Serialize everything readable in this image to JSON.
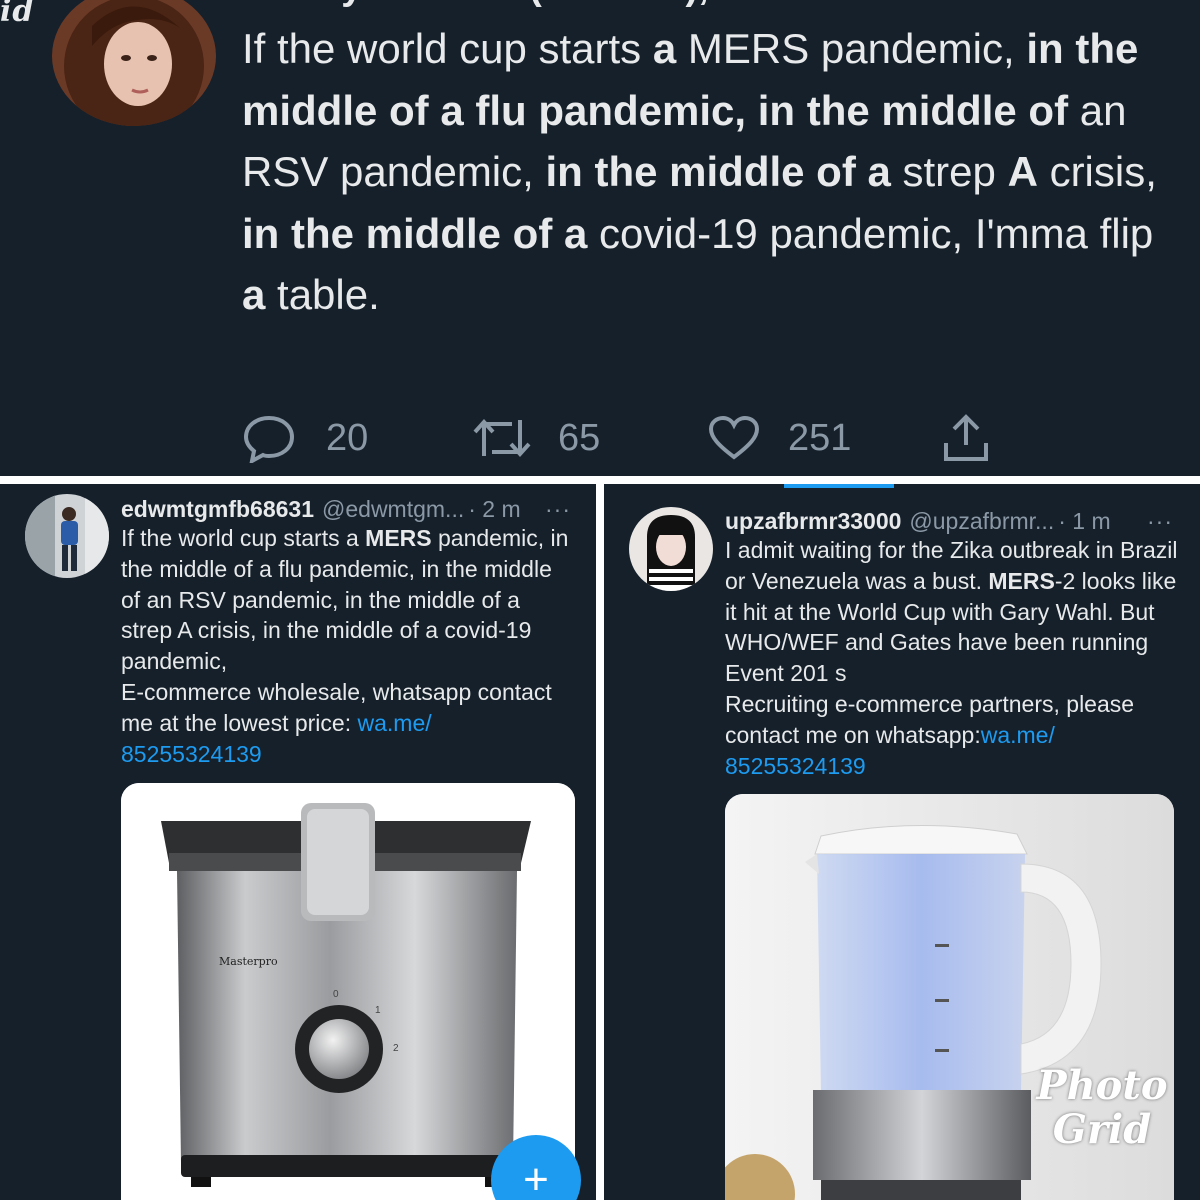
{
  "top_tweet": {
    "corner_mark": "id",
    "author_cut": "Kathryn Henzie (She/Her), Realit",
    "segments": [
      {
        "t": "If the world cup starts ",
        "b": false
      },
      {
        "t": "a",
        "b": true
      },
      {
        "t": " MERS pandemic, ",
        "b": false
      },
      {
        "t": "in the middle of a flu pandemic, in the middle of",
        "b": true
      },
      {
        "t": " an RSV pandemic, ",
        "b": false
      },
      {
        "t": "in the middle of a",
        "b": true
      },
      {
        "t": " strep ",
        "b": false
      },
      {
        "t": "A",
        "b": true
      },
      {
        "t": " crisis, ",
        "b": false
      },
      {
        "t": "in the middle of a",
        "b": true
      },
      {
        "t": " covid-19 pandemic, I'mma flip ",
        "b": false
      },
      {
        "t": "a",
        "b": true
      },
      {
        "t": " table.",
        "b": false
      }
    ],
    "replies": "20",
    "retweets": "65",
    "likes": "251",
    "icons": [
      "reply-icon",
      "retweet-icon",
      "like-icon",
      "share-icon"
    ]
  },
  "left_tweet": {
    "name": "edwmtgmfb68631",
    "handle": "@edwmtgm...",
    "time": "· 2 m",
    "more": "···",
    "segments": [
      {
        "t": "If the world cup starts a ",
        "b": false
      },
      {
        "t": "MERS",
        "b": true
      },
      {
        "t": " pandemic, in the middle of a flu pandemic, in the middle of an RSV pandemic, in the middle of a strep A crisis, in the middle of a covid-19 pandemic,",
        "b": false
      }
    ],
    "line2": "E-commerce wholesale, whatsapp contact me at the lowest price: ",
    "link": "wa.me/ 85255324139",
    "media_brand": "Masterpro",
    "media_dial_marks": [
      "0",
      "1",
      "2"
    ],
    "fab_label": "+"
  },
  "right_tweet": {
    "name": "upzafbrmr33000",
    "handle": "@upzafbrmr...",
    "time": "· 1 m",
    "more": "···",
    "segments": [
      {
        "t": "I admit waiting for the Zika outbreak in Brazil or Venezuela was a bust. ",
        "b": false
      },
      {
        "t": "MERS",
        "b": true
      },
      {
        "t": "-2 looks like it hit at the World Cup with Gary Wahl. But WHO/WEF and Gates have been running Event 201 s",
        "b": false
      }
    ],
    "line2": "Recruiting e-commerce partners, please contact me on whatsapp:",
    "link": "wa.me/ 85255324139",
    "watermark": "Photo Grid"
  },
  "colors": {
    "background": "#15202b",
    "text": "#e7e9ea",
    "muted": "#8b98a5",
    "link": "#1d9bf0"
  }
}
